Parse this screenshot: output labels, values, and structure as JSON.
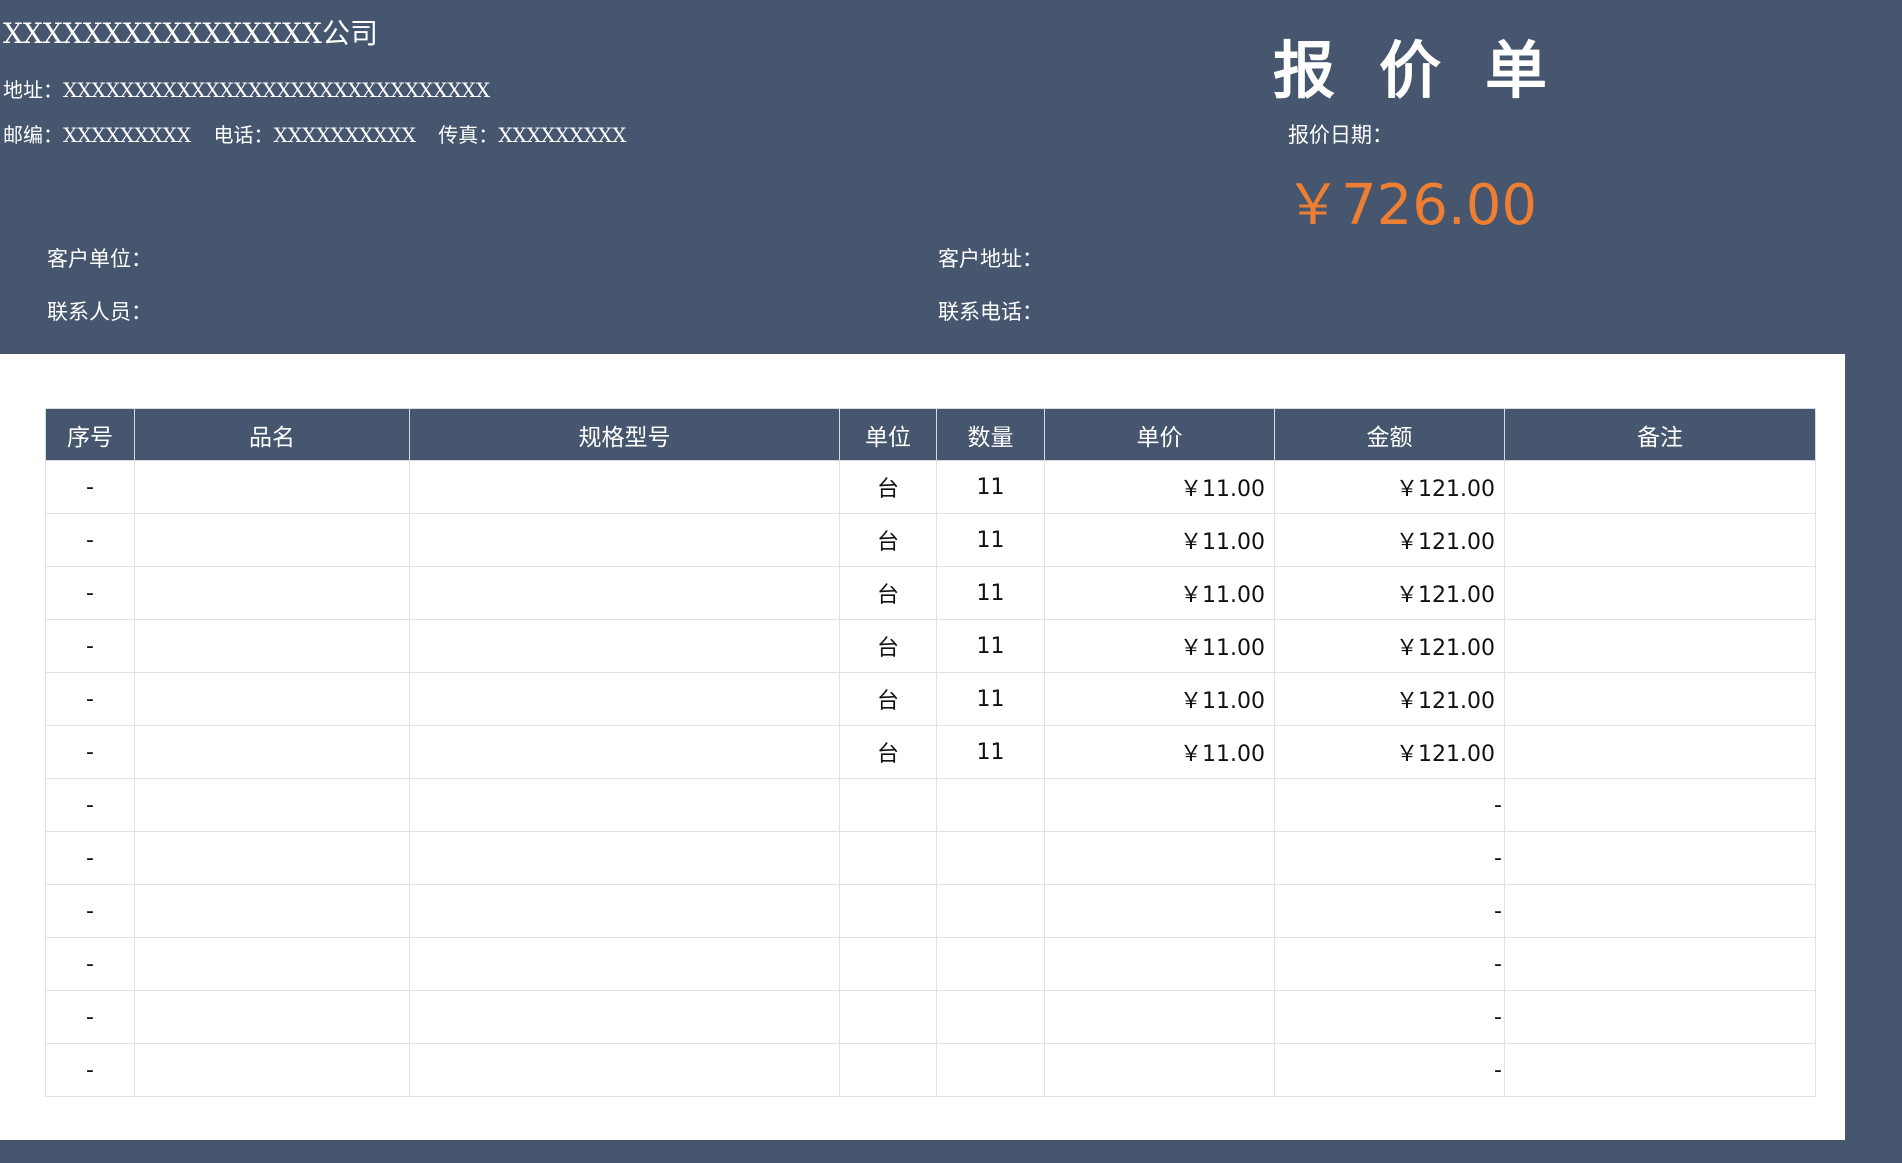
{
  "company": {
    "name": "XXXXXXXXXXXXXXXX公司",
    "address": "地址：XXXXXXXXXXXXXXXXXXXXXXXXXXXXXX",
    "postcode": "邮编：XXXXXXXXX",
    "phone": "电话：XXXXXXXXXX",
    "fax": "传真：XXXXXXXXX"
  },
  "document": {
    "title": "报价单",
    "date_label": "报价日期：",
    "total": "￥726.00"
  },
  "customer": {
    "unit_label": "客户单位：",
    "address_label": "客户地址：",
    "contact_label": "联系人员：",
    "phone_label": "联系电话："
  },
  "colors": {
    "navy": "#46566e",
    "accent_orange": "#ee7f32"
  },
  "table": {
    "headers": [
      "序号",
      "品名",
      "规格型号",
      "单位",
      "数量",
      "单价",
      "金额",
      "备注"
    ],
    "rows": [
      {
        "seq": "-",
        "name": "",
        "spec": "",
        "unit": "台",
        "qty": "11",
        "price": "￥11.00",
        "amount": "￥121.00",
        "note": ""
      },
      {
        "seq": "-",
        "name": "",
        "spec": "",
        "unit": "台",
        "qty": "11",
        "price": "￥11.00",
        "amount": "￥121.00",
        "note": ""
      },
      {
        "seq": "-",
        "name": "",
        "spec": "",
        "unit": "台",
        "qty": "11",
        "price": "￥11.00",
        "amount": "￥121.00",
        "note": ""
      },
      {
        "seq": "-",
        "name": "",
        "spec": "",
        "unit": "台",
        "qty": "11",
        "price": "￥11.00",
        "amount": "￥121.00",
        "note": ""
      },
      {
        "seq": "-",
        "name": "",
        "spec": "",
        "unit": "台",
        "qty": "11",
        "price": "￥11.00",
        "amount": "￥121.00",
        "note": ""
      },
      {
        "seq": "-",
        "name": "",
        "spec": "",
        "unit": "台",
        "qty": "11",
        "price": "￥11.00",
        "amount": "￥121.00",
        "note": ""
      },
      {
        "seq": "-",
        "name": "",
        "spec": "",
        "unit": "",
        "qty": "",
        "price": "",
        "amount": "-",
        "note": ""
      },
      {
        "seq": "-",
        "name": "",
        "spec": "",
        "unit": "",
        "qty": "",
        "price": "",
        "amount": "-",
        "note": ""
      },
      {
        "seq": "-",
        "name": "",
        "spec": "",
        "unit": "",
        "qty": "",
        "price": "",
        "amount": "-",
        "note": ""
      },
      {
        "seq": "-",
        "name": "",
        "spec": "",
        "unit": "",
        "qty": "",
        "price": "",
        "amount": "-",
        "note": ""
      },
      {
        "seq": "-",
        "name": "",
        "spec": "",
        "unit": "",
        "qty": "",
        "price": "",
        "amount": "-",
        "note": ""
      },
      {
        "seq": "-",
        "name": "",
        "spec": "",
        "unit": "",
        "qty": "",
        "price": "",
        "amount": "-",
        "note": ""
      }
    ]
  }
}
